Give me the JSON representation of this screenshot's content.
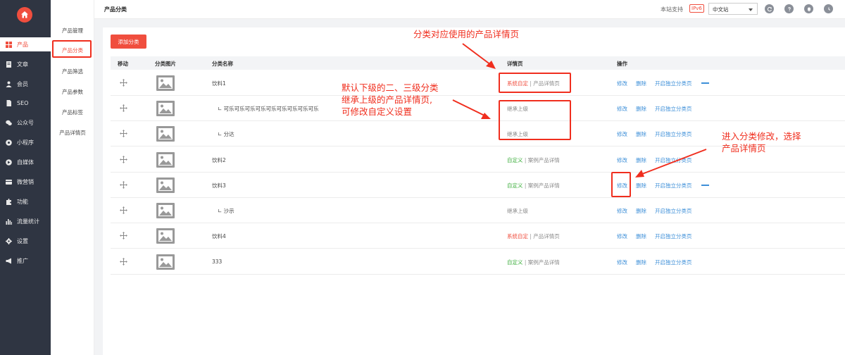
{
  "sidebar": {
    "items": [
      {
        "label": "产品",
        "icon": "grid-icon",
        "active": true
      },
      {
        "label": "文章",
        "icon": "document-icon"
      },
      {
        "label": "会员",
        "icon": "user-icon"
      },
      {
        "label": "SEO",
        "icon": "file-icon"
      },
      {
        "label": "公众号",
        "icon": "wechat-icon"
      },
      {
        "label": "小程序",
        "icon": "mini-program-icon"
      },
      {
        "label": "自媒体",
        "icon": "media-icon"
      },
      {
        "label": "微营销",
        "icon": "marketing-icon"
      },
      {
        "label": "功能",
        "icon": "puzzle-icon"
      },
      {
        "label": "流量统计",
        "icon": "bar-chart-icon"
      },
      {
        "label": "设置",
        "icon": "gear-icon"
      },
      {
        "label": "推广",
        "icon": "megaphone-icon"
      }
    ]
  },
  "subnav": {
    "items": [
      "产品管理",
      "产品分类",
      "产品筛选",
      "产品参数",
      "产品标签",
      "产品详情页"
    ],
    "active_index": 1
  },
  "topbar": {
    "title": "产品分类",
    "site_support": "本站支持",
    "ipv6_badge": "IPv6",
    "language": "中文站",
    "icons": [
      "refresh-icon",
      "help-icon",
      "bell-icon",
      "clock-icon"
    ]
  },
  "toolbar": {
    "add_label": "添加分类"
  },
  "table": {
    "headers": {
      "move": "移动",
      "image": "分类图片",
      "name": "分类名称",
      "detail": "详情页",
      "ops": "操作"
    },
    "rows": [
      {
        "name": "饮料1",
        "detail_type": "系统自定",
        "detail_page": "产品详情页",
        "detail_color": "red",
        "expand": true
      },
      {
        "name": "∟ 可乐可乐可乐可乐可乐可乐可乐可乐可乐",
        "detail_inherit": "继承上级"
      },
      {
        "name": "∟ 分达",
        "detail_inherit": "继承上级"
      },
      {
        "name": "饮料2",
        "detail_type": "自定义",
        "detail_page": "案例产品详情",
        "detail_color": "green"
      },
      {
        "name": "饮料3",
        "detail_type": "自定义",
        "detail_page": "案例产品详情",
        "detail_color": "green",
        "expand": true
      },
      {
        "name": "∟ 沙示",
        "detail_inherit": "继承上级"
      },
      {
        "name": "饮料4",
        "detail_type": "系统自定",
        "detail_page": "产品详情页",
        "detail_color": "red"
      },
      {
        "name": "333",
        "detail_type": "自定义",
        "detail_page": "案例产品详情",
        "detail_color": "green"
      }
    ],
    "ops": {
      "edit": "修改",
      "delete": "删除",
      "open_page": "开启独立分类页"
    }
  },
  "annotations": {
    "a1": "分类对应使用的产品详情页",
    "a2_line1": "默认下级的二、三级分类",
    "a2_line2": "继承上级的产品详情页,",
    "a2_line3": "可修改自定义设置",
    "a3_line1": "进入分类修改，选择",
    "a3_line2": "产品详情页"
  },
  "colors": {
    "accent": "#f04e3e",
    "annotation": "#f02e1e",
    "link": "#3d8fd8",
    "sidebar": "#2f3542",
    "green": "#3cae3c"
  }
}
